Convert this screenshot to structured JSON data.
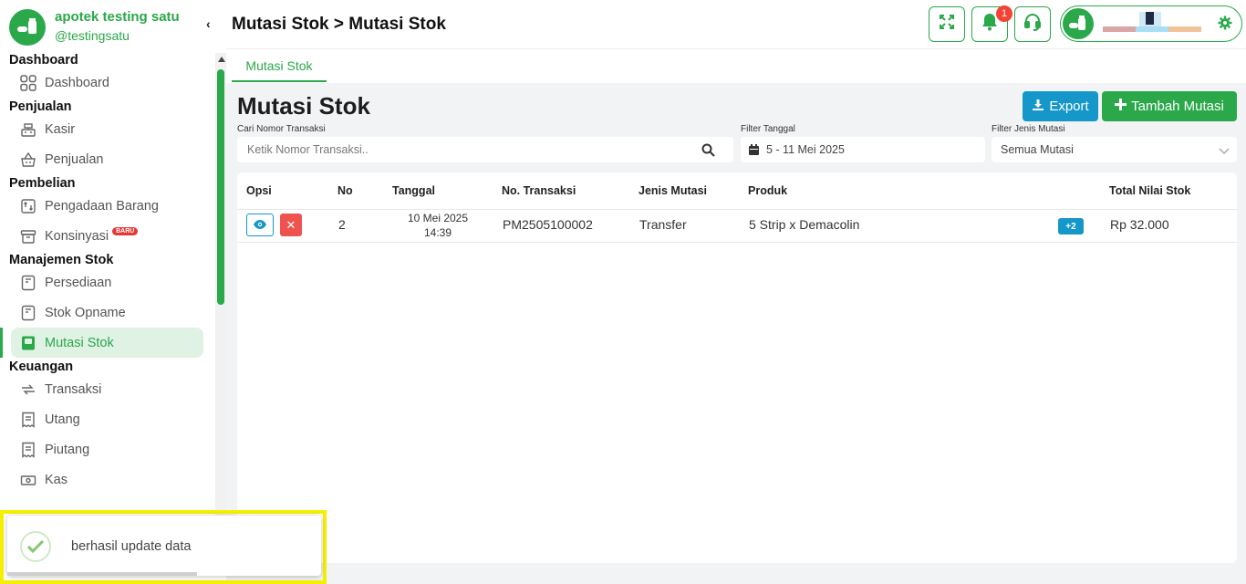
{
  "brand": {
    "name": "apotek testing satu",
    "username": "@testingsatu"
  },
  "sidebar": {
    "sections": [
      {
        "title": "Dashboard",
        "items": [
          {
            "label": "Dashboard",
            "icon": "grid-icon"
          }
        ]
      },
      {
        "title": "Penjualan",
        "items": [
          {
            "label": "Kasir",
            "icon": "cash-register-icon"
          },
          {
            "label": "Penjualan",
            "icon": "basket-icon"
          }
        ]
      },
      {
        "title": "Pembelian",
        "items": [
          {
            "label": "Pengadaan Barang",
            "icon": "procurement-icon"
          },
          {
            "label": "Konsinyasi",
            "icon": "archive-box-icon",
            "badge": "BARU"
          }
        ]
      },
      {
        "title": "Manajemen Stok",
        "items": [
          {
            "label": "Persediaan",
            "icon": "inventory-icon"
          },
          {
            "label": "Stok Opname",
            "icon": "stock-opname-icon"
          },
          {
            "label": "Mutasi Stok",
            "icon": "stock-mutation-icon",
            "active": true
          }
        ]
      },
      {
        "title": "Keuangan",
        "items": [
          {
            "label": "Transaksi",
            "icon": "transaction-icon"
          },
          {
            "label": "Utang",
            "icon": "receipt-icon"
          },
          {
            "label": "Piutang",
            "icon": "receipt-icon"
          },
          {
            "label": "Kas",
            "icon": "cash-icon"
          }
        ]
      }
    ]
  },
  "header": {
    "breadcrumb": "Mutasi Stok > Mutasi Stok",
    "notification_count": "1"
  },
  "tabs": [
    {
      "label": "Mutasi Stok"
    }
  ],
  "main": {
    "title": "Mutasi Stok",
    "export_label": "Export",
    "add_label": "Tambah Mutasi",
    "filters": {
      "search_label": "Cari Nomor Transaksi",
      "search_placeholder": "Ketik Nomor Transaksi..",
      "date_label": "Filter Tanggal",
      "date_value": "5 - 11 Mei 2025",
      "type_label": "Filter Jenis Mutasi",
      "type_value": "Semua Mutasi"
    },
    "table": {
      "columns": [
        "Opsi",
        "No",
        "Tanggal",
        "No. Transaksi",
        "Jenis Mutasi",
        "Produk",
        "Total Nilai Stok"
      ],
      "rows": [
        {
          "no": "2",
          "date": "10 Mei 2025",
          "time": "14:39",
          "transaction_no": "PM2505100002",
          "type": "Transfer",
          "product": "5 Strip x Demacolin",
          "more": "+2",
          "total": "Rp 32.000"
        }
      ]
    }
  },
  "toast": {
    "message": "berhasil update data"
  },
  "colors": {
    "brand_green": "#2aa84a",
    "info_blue": "#1597c9",
    "danger_red": "#ef5350"
  }
}
